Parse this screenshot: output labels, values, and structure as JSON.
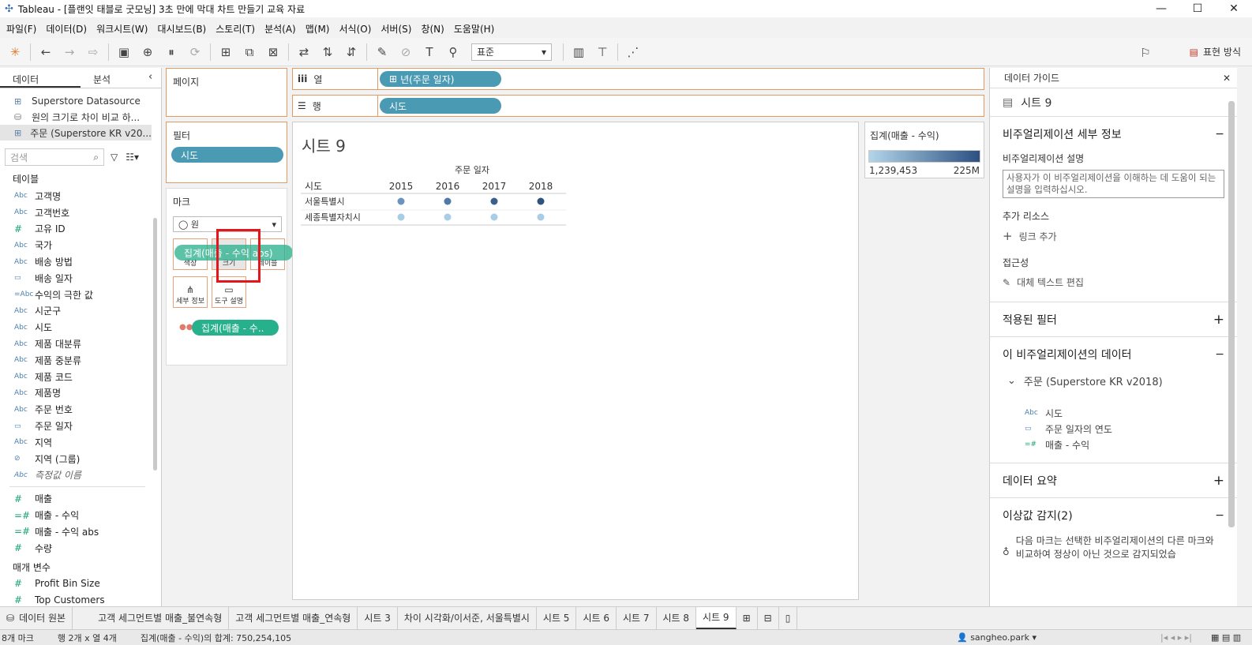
{
  "window": {
    "title": "Tableau - [플랜잇 태블로 굿모닝] 3초 만에 막대 차트 만들기 교육 자료"
  },
  "menu": [
    "파일(F)",
    "데이터(D)",
    "워크시트(W)",
    "대시보드(B)",
    "스토리(T)",
    "분석(A)",
    "맵(M)",
    "서식(O)",
    "서버(S)",
    "창(N)",
    "도움말(H)"
  ],
  "toolbar": {
    "fit": "표준",
    "show_me": "표현 방식"
  },
  "left": {
    "tab_data": "데이터",
    "tab_analysis": "분석",
    "datasources": [
      "Superstore Datasource",
      "원의 크기로 차이 비교 하...",
      "주문 (Superstore KR v20..."
    ],
    "search_placeholder": "검색",
    "tables_title": "테이블",
    "dimensions": [
      {
        "ic": "Abc",
        "name": "고객명"
      },
      {
        "ic": "Abc",
        "name": "고객번호"
      },
      {
        "ic": "#",
        "name": "고유 ID"
      },
      {
        "ic": "Abc",
        "name": "국가"
      },
      {
        "ic": "Abc",
        "name": "배송 방법"
      },
      {
        "ic": "cal",
        "name": "배송 일자"
      },
      {
        "ic": "=Abc",
        "name": "수익의 극한 값"
      },
      {
        "ic": "Abc",
        "name": "시군구"
      },
      {
        "ic": "Abc",
        "name": "시도"
      },
      {
        "ic": "Abc",
        "name": "제품 대분류"
      },
      {
        "ic": "Abc",
        "name": "제품 중분류"
      },
      {
        "ic": "Abc",
        "name": "제품 코드"
      },
      {
        "ic": "Abc",
        "name": "제품명"
      },
      {
        "ic": "Abc",
        "name": "주문 번호"
      },
      {
        "ic": "cal",
        "name": "주문 일자"
      },
      {
        "ic": "Abc",
        "name": "지역"
      },
      {
        "ic": "clip",
        "name": "지역 (그룹)"
      },
      {
        "ic": "Abc",
        "name": "측정값 이름"
      }
    ],
    "measures": [
      {
        "ic": "#",
        "name": "매출"
      },
      {
        "ic": "=#",
        "name": "매출 - 수익"
      },
      {
        "ic": "=#",
        "name": "매출 - 수익 abs"
      },
      {
        "ic": "#",
        "name": "수량"
      }
    ],
    "params_title": "매개 변수",
    "params": [
      {
        "ic": "#",
        "name": "Profit Bin Size"
      },
      {
        "ic": "#",
        "name": "Top Customers"
      }
    ]
  },
  "shelves": {
    "pages": "페이지",
    "filters": "필터",
    "filter_pill": "시도",
    "marks": "마크",
    "mark_type": "원",
    "mark_color": "색상",
    "mark_size": "크기",
    "mark_label": "레이블",
    "mark_detail": "세부 정보",
    "mark_tooltip": "도구 설명",
    "color_pill": "집계(매출 - 수..",
    "drag_pill": "집계(매출 - 수익 abs)",
    "columns": "열",
    "column_pill": "년(주문 일자)",
    "rows": "행",
    "row_pill": "시도"
  },
  "view": {
    "title": "시트 9",
    "col_header": "주문 일자",
    "row_header": "시도",
    "years": [
      "2015",
      "2016",
      "2017",
      "2018"
    ],
    "rows": [
      "서울특별시",
      "세종특별자치시"
    ]
  },
  "chart_data": {
    "type": "scatter",
    "title": "시트 9",
    "x_label": "주문 일자",
    "categories": [
      "2015",
      "2016",
      "2017",
      "2018"
    ],
    "rows": [
      "서울특별시",
      "세종특별자치시"
    ],
    "color_field": "집계(매출 - 수익)",
    "series": [
      {
        "name": "서울특별시",
        "colors": [
          "#6b93bd",
          "#4f79a8",
          "#3a5f8c",
          "#2d5381"
        ]
      },
      {
        "name": "세종특별자치시",
        "colors": [
          "#a8cde6",
          "#a8cde6",
          "#a8cde6",
          "#a8cde6"
        ]
      }
    ],
    "legend": {
      "title": "집계(매출 - 수익)",
      "min_label": "1,239,453",
      "max_label": "225M"
    }
  },
  "guide": {
    "title": "데이터 가이드",
    "sheet": "시트 9",
    "details_title": "비주얼리제이션 세부 정보",
    "desc_label": "비주얼리제이션 설명",
    "desc_placeholder": "사용자가 이 비주얼리제이션을 이해하는 데 도움이 되는 설명을 입력하십시오.",
    "resources_label": "추가 리소스",
    "add_link": "링크 추가",
    "access_label": "접근성",
    "alt_text": "대체 텍스트 편집",
    "filters_title": "적용된 필터",
    "data_title": "이 비주얼리제이션의 데이터",
    "source": "주문 (Superstore KR v2018)",
    "data_fields": [
      {
        "ic": "Abc",
        "name": "시도"
      },
      {
        "ic": "cal",
        "name": "주문 일자의 연도"
      },
      {
        "ic": "=#",
        "name": "매출 - 수익"
      }
    ],
    "summary_title": "데이터 요약",
    "outlier_title": "이상값 감지(2)",
    "outlier_text": "다음 마크는 선택한 비주얼리제이션의 다른 마크와 비교하여 정상이 아닌 것으로 감지되었습"
  },
  "bottom_tabs": [
    "데이터 원본",
    "고객 세그먼트별 매출_불연속형",
    "고객 세그먼트별 매출_연속형",
    "시트 3",
    "차이 시각화/이서준, 서울특별시",
    "시트 5",
    "시트 6",
    "시트 7",
    "시트 8",
    "시트 9"
  ],
  "status": {
    "marks": "8개 마크",
    "rows_cols": "행 2개 x 열 4개",
    "sum": "집계(매출 - 수익)의 합계: 750,254,105",
    "user": "sangheo.park"
  }
}
